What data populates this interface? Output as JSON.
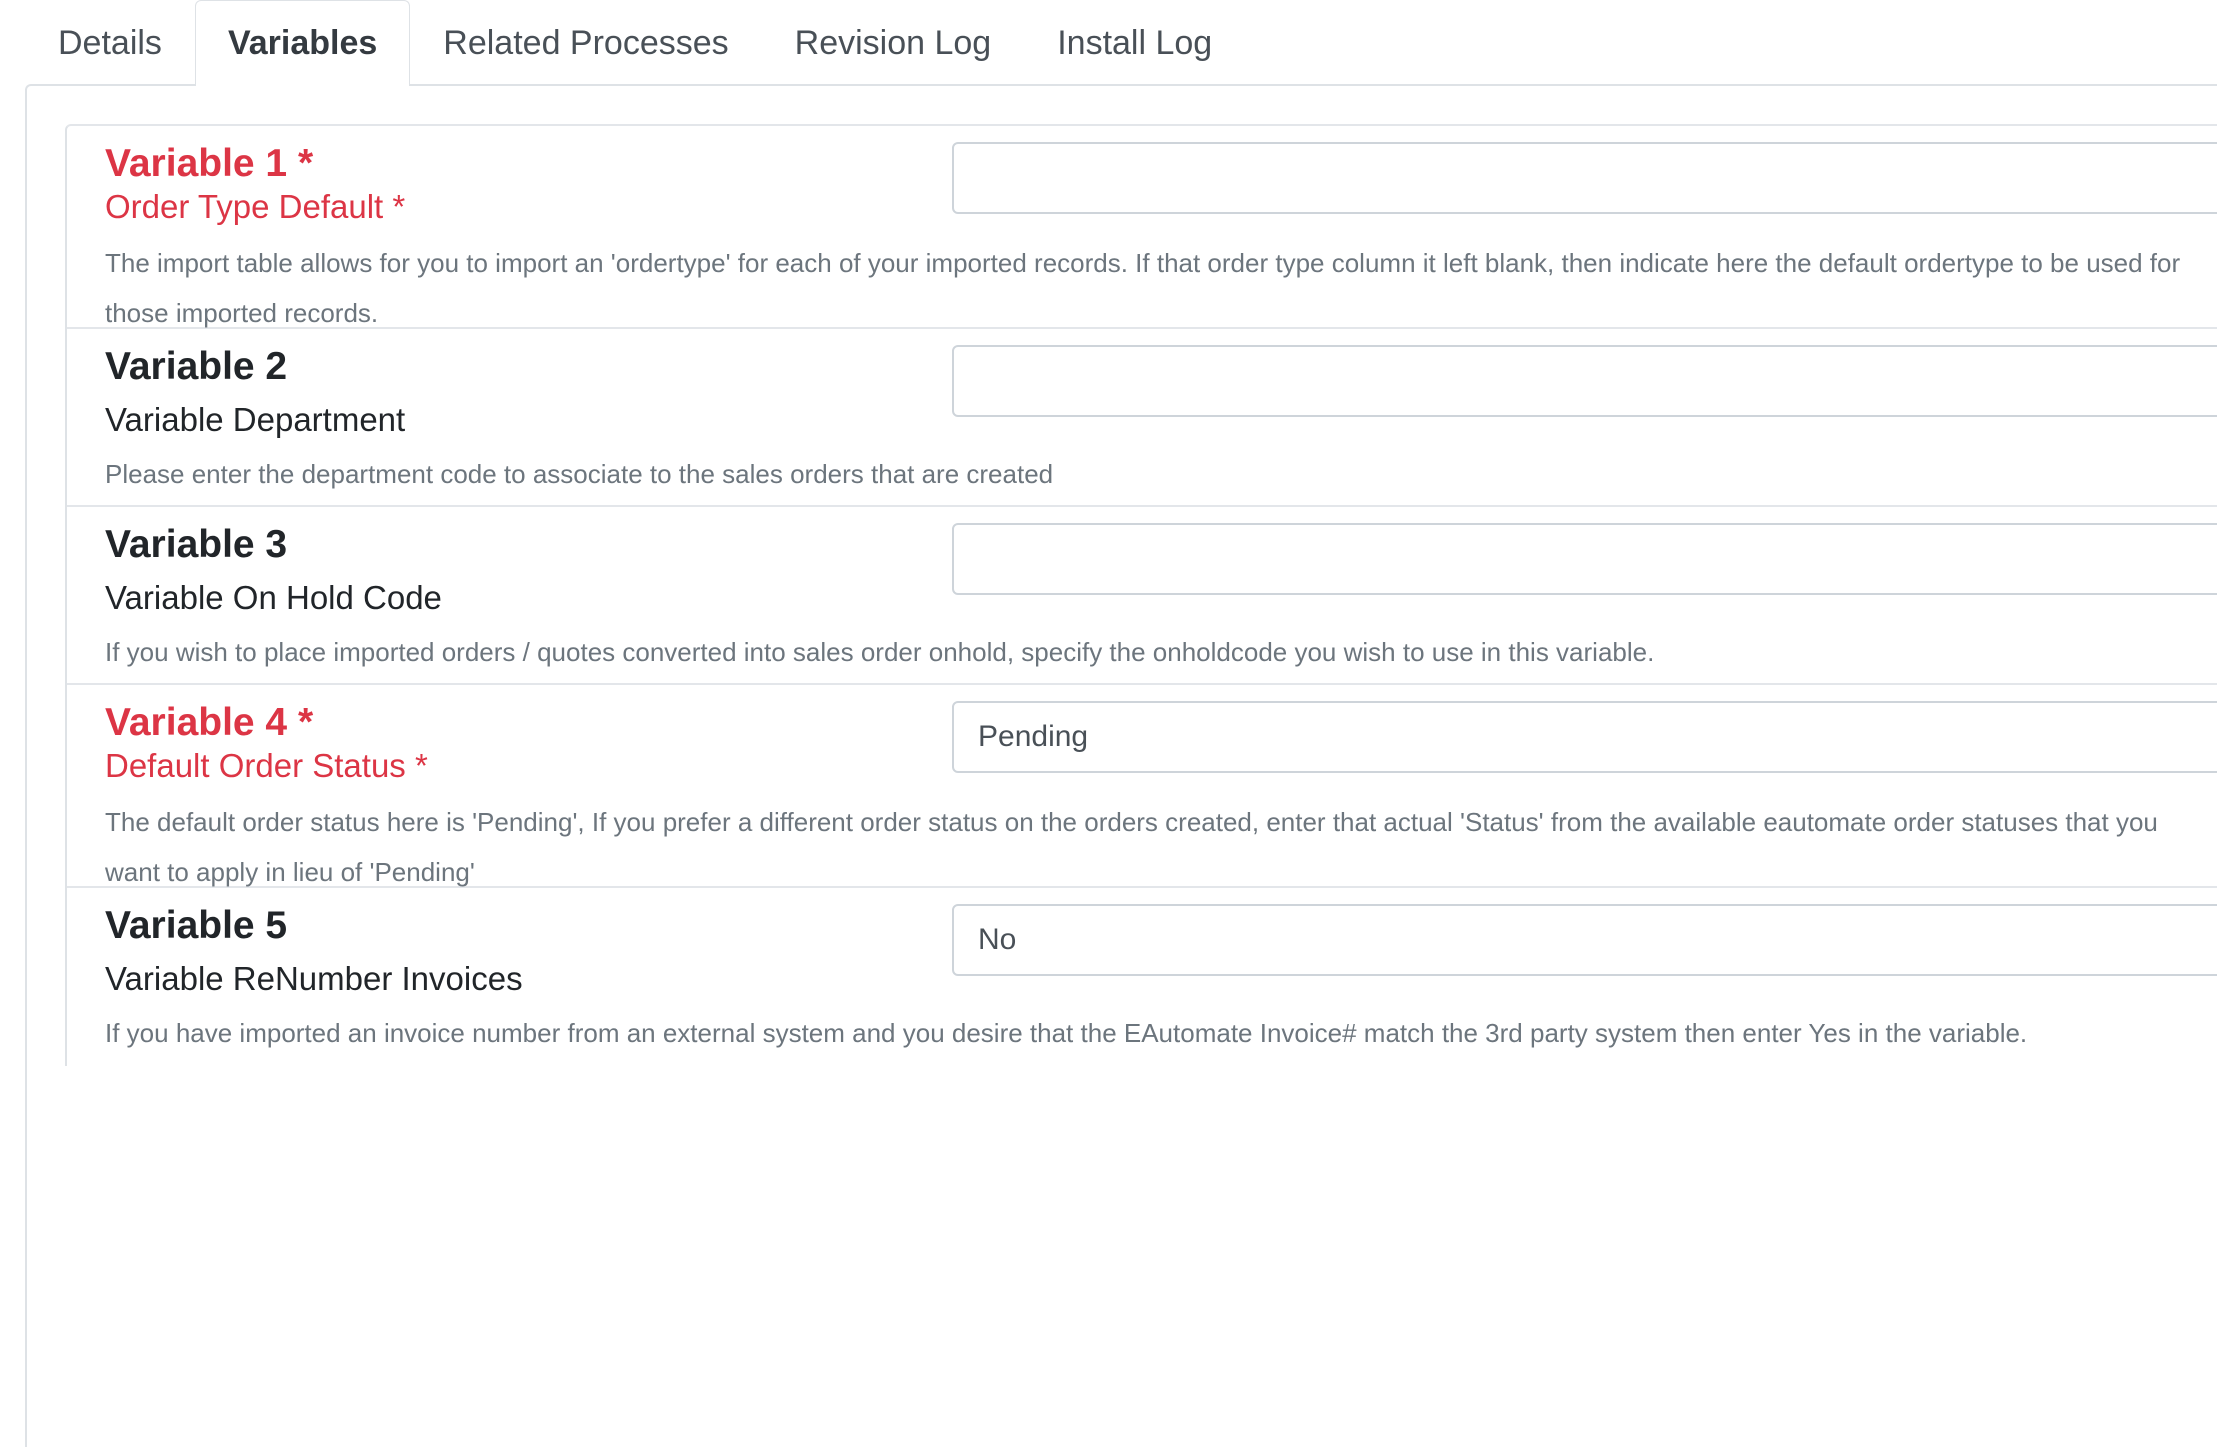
{
  "tabs": [
    "Details",
    "Variables",
    "Related Processes",
    "Revision Log",
    "Install Log"
  ],
  "active_tab": "Variables",
  "variables": [
    {
      "title": "Variable 1 *",
      "subtitle": "Order Type Default *",
      "value": "",
      "required": true,
      "description": "The import table allows for you to import an 'ordertype' for each of your imported records. If that order type column it left blank, then indicate here the default ordertype to be used for those imported records."
    },
    {
      "title": "Variable 2",
      "subtitle": "Variable Department",
      "value": "",
      "required": false,
      "description": "Please enter the department code to associate to the sales orders that are created"
    },
    {
      "title": "Variable 3",
      "subtitle": "Variable On Hold Code",
      "value": "",
      "required": false,
      "description": "If you wish to place imported orders / quotes converted into sales order onhold, specify the onholdcode you wish to use in this variable."
    },
    {
      "title": "Variable 4 *",
      "subtitle": "Default Order Status *",
      "value": "Pending",
      "required": true,
      "description": "The default order status here is 'Pending', If you prefer a different order status on the orders created, enter that actual 'Status' from the available eautomate order statuses that you want to apply in lieu of 'Pending'"
    },
    {
      "title": "Variable 5",
      "subtitle": "Variable ReNumber Invoices",
      "value": "No",
      "required": false,
      "description": "If you have imported an invoice number from an external system and  you desire that the EAutomate Invoice# match the 3rd party system then enter Yes in the variable."
    }
  ],
  "colors": {
    "required": "#dc3545",
    "normal_text": "#212529",
    "muted_text": "#6c757d",
    "border": "#dee2e6"
  }
}
